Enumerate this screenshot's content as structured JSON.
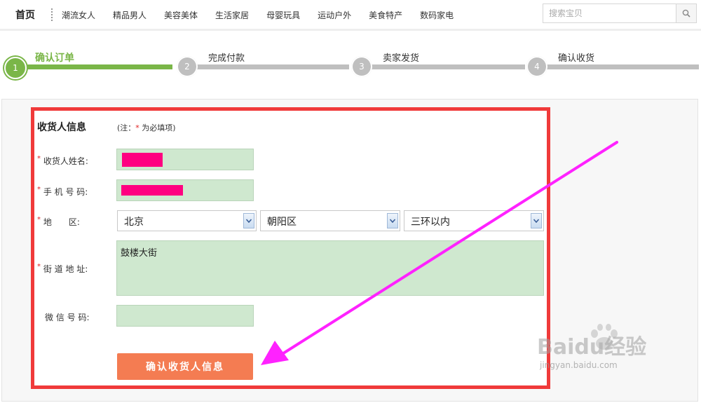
{
  "nav": {
    "home": "首页",
    "categories": [
      "潮流女人",
      "精品男人",
      "美容美体",
      "生活家居",
      "母婴玩具",
      "运动户外",
      "美食特产",
      "数码家电"
    ],
    "search_placeholder": "搜索宝贝"
  },
  "steps": [
    {
      "number": "1",
      "label": "确认订单",
      "active": true
    },
    {
      "number": "2",
      "label": "完成付款",
      "active": false
    },
    {
      "number": "3",
      "label": "卖家发货",
      "active": false
    },
    {
      "number": "4",
      "label": "确认收货",
      "active": false
    }
  ],
  "form": {
    "title": "收货人信息",
    "note_prefix": "(注：",
    "note_star": "*",
    "note_suffix": " 为必填项)",
    "name_label": "收货人姓名:",
    "phone_label": "手 机 号 码:",
    "region_label": "地　　区:",
    "street_label": "街 道 地 址:",
    "wechat_label": "微 信 号 码:",
    "province": "北京",
    "district": "朝阳区",
    "area": "三环以内",
    "street_value": "鼓楼大街",
    "submit_label": "确认收货人信息"
  },
  "colors": {
    "accent_green": "#7ab648",
    "field_bg": "#cfe8cf",
    "highlight_red": "#f03a3a",
    "button_orange": "#f47c52",
    "redaction": "#ff0080",
    "arrow": "#ff22ff"
  },
  "watermark": {
    "brand": "Baidu经验",
    "url": "jingyan.baidu.com"
  }
}
